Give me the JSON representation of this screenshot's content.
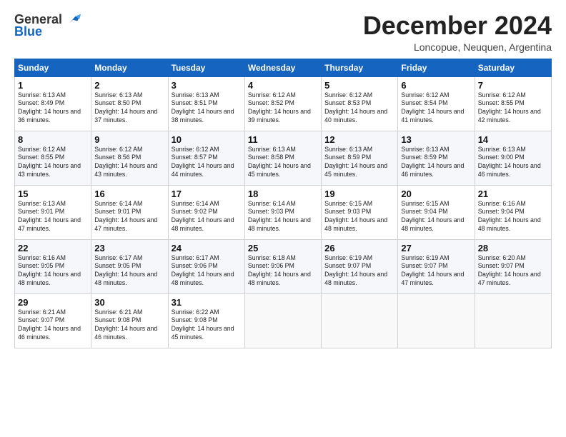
{
  "header": {
    "logo_general": "General",
    "logo_blue": "Blue",
    "month_title": "December 2024",
    "location": "Loncopue, Neuquen, Argentina"
  },
  "days_of_week": [
    "Sunday",
    "Monday",
    "Tuesday",
    "Wednesday",
    "Thursday",
    "Friday",
    "Saturday"
  ],
  "weeks": [
    [
      {
        "day": 1,
        "sunrise": "6:13 AM",
        "sunset": "8:49 PM",
        "daylight": "14 hours and 36 minutes."
      },
      {
        "day": 2,
        "sunrise": "6:13 AM",
        "sunset": "8:50 PM",
        "daylight": "14 hours and 37 minutes."
      },
      {
        "day": 3,
        "sunrise": "6:13 AM",
        "sunset": "8:51 PM",
        "daylight": "14 hours and 38 minutes."
      },
      {
        "day": 4,
        "sunrise": "6:12 AM",
        "sunset": "8:52 PM",
        "daylight": "14 hours and 39 minutes."
      },
      {
        "day": 5,
        "sunrise": "6:12 AM",
        "sunset": "8:53 PM",
        "daylight": "14 hours and 40 minutes."
      },
      {
        "day": 6,
        "sunrise": "6:12 AM",
        "sunset": "8:54 PM",
        "daylight": "14 hours and 41 minutes."
      },
      {
        "day": 7,
        "sunrise": "6:12 AM",
        "sunset": "8:55 PM",
        "daylight": "14 hours and 42 minutes."
      }
    ],
    [
      {
        "day": 8,
        "sunrise": "6:12 AM",
        "sunset": "8:55 PM",
        "daylight": "14 hours and 43 minutes."
      },
      {
        "day": 9,
        "sunrise": "6:12 AM",
        "sunset": "8:56 PM",
        "daylight": "14 hours and 43 minutes."
      },
      {
        "day": 10,
        "sunrise": "6:12 AM",
        "sunset": "8:57 PM",
        "daylight": "14 hours and 44 minutes."
      },
      {
        "day": 11,
        "sunrise": "6:13 AM",
        "sunset": "8:58 PM",
        "daylight": "14 hours and 45 minutes."
      },
      {
        "day": 12,
        "sunrise": "6:13 AM",
        "sunset": "8:59 PM",
        "daylight": "14 hours and 45 minutes."
      },
      {
        "day": 13,
        "sunrise": "6:13 AM",
        "sunset": "8:59 PM",
        "daylight": "14 hours and 46 minutes."
      },
      {
        "day": 14,
        "sunrise": "6:13 AM",
        "sunset": "9:00 PM",
        "daylight": "14 hours and 46 minutes."
      }
    ],
    [
      {
        "day": 15,
        "sunrise": "6:13 AM",
        "sunset": "9:01 PM",
        "daylight": "14 hours and 47 minutes."
      },
      {
        "day": 16,
        "sunrise": "6:14 AM",
        "sunset": "9:01 PM",
        "daylight": "14 hours and 47 minutes."
      },
      {
        "day": 17,
        "sunrise": "6:14 AM",
        "sunset": "9:02 PM",
        "daylight": "14 hours and 48 minutes."
      },
      {
        "day": 18,
        "sunrise": "6:14 AM",
        "sunset": "9:03 PM",
        "daylight": "14 hours and 48 minutes."
      },
      {
        "day": 19,
        "sunrise": "6:15 AM",
        "sunset": "9:03 PM",
        "daylight": "14 hours and 48 minutes."
      },
      {
        "day": 20,
        "sunrise": "6:15 AM",
        "sunset": "9:04 PM",
        "daylight": "14 hours and 48 minutes."
      },
      {
        "day": 21,
        "sunrise": "6:16 AM",
        "sunset": "9:04 PM",
        "daylight": "14 hours and 48 minutes."
      }
    ],
    [
      {
        "day": 22,
        "sunrise": "6:16 AM",
        "sunset": "9:05 PM",
        "daylight": "14 hours and 48 minutes."
      },
      {
        "day": 23,
        "sunrise": "6:17 AM",
        "sunset": "9:05 PM",
        "daylight": "14 hours and 48 minutes."
      },
      {
        "day": 24,
        "sunrise": "6:17 AM",
        "sunset": "9:06 PM",
        "daylight": "14 hours and 48 minutes."
      },
      {
        "day": 25,
        "sunrise": "6:18 AM",
        "sunset": "9:06 PM",
        "daylight": "14 hours and 48 minutes."
      },
      {
        "day": 26,
        "sunrise": "6:19 AM",
        "sunset": "9:07 PM",
        "daylight": "14 hours and 48 minutes."
      },
      {
        "day": 27,
        "sunrise": "6:19 AM",
        "sunset": "9:07 PM",
        "daylight": "14 hours and 47 minutes."
      },
      {
        "day": 28,
        "sunrise": "6:20 AM",
        "sunset": "9:07 PM",
        "daylight": "14 hours and 47 minutes."
      }
    ],
    [
      {
        "day": 29,
        "sunrise": "6:21 AM",
        "sunset": "9:07 PM",
        "daylight": "14 hours and 46 minutes."
      },
      {
        "day": 30,
        "sunrise": "6:21 AM",
        "sunset": "9:08 PM",
        "daylight": "14 hours and 46 minutes."
      },
      {
        "day": 31,
        "sunrise": "6:22 AM",
        "sunset": "9:08 PM",
        "daylight": "14 hours and 45 minutes."
      },
      null,
      null,
      null,
      null
    ]
  ]
}
